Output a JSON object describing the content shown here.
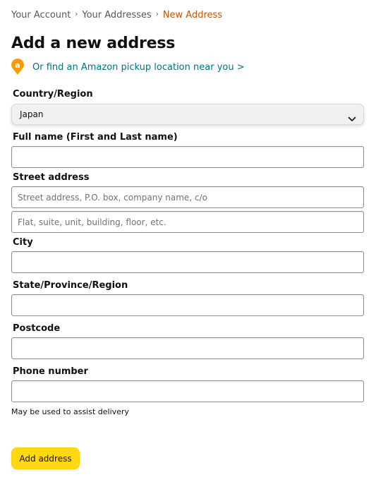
{
  "breadcrumb": {
    "items": [
      "Your Account",
      "Your Addresses"
    ],
    "separator": "›",
    "current": "New Address"
  },
  "page": {
    "title": "Add a new address"
  },
  "pickup": {
    "icon_letter": "a",
    "icon": "location-pin-icon",
    "link_text": "Or find an Amazon pickup location near you >"
  },
  "country": {
    "label": "Country/Region",
    "value": "Japan",
    "icon": "chevron-down-icon"
  },
  "full_name": {
    "label": "Full name (First and Last name)",
    "value": "",
    "placeholder": ""
  },
  "street": {
    "label": "Street address",
    "line1_placeholder": "Street address, P.O. box, company name, c/o",
    "line2_placeholder": "Flat, suite, unit, building, floor, etc.",
    "line1_value": "",
    "line2_value": ""
  },
  "city": {
    "label": "City",
    "value": ""
  },
  "state": {
    "label": "State/Province/Region",
    "value": ""
  },
  "postcode": {
    "label": "Postcode",
    "value": ""
  },
  "phone": {
    "label": "Phone number",
    "value": "",
    "helper": "May be used to assist delivery"
  },
  "submit": {
    "label": "Add address"
  },
  "colors": {
    "link": "#007185",
    "breadcrumb_current": "#c45500",
    "pin": "#ff9900",
    "button": "#ffd814",
    "text": "#0f1111"
  }
}
